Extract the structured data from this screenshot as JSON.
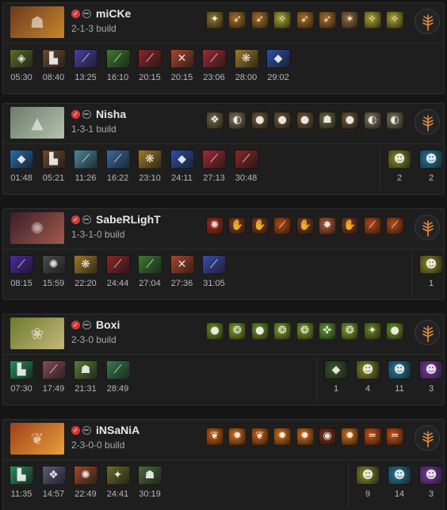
{
  "colors": {
    "background": "#151515",
    "card": "#1e1e1e",
    "check_badge": "#d23a3a",
    "talent_accent": "#e08a3c"
  },
  "players": [
    {
      "name": "miCKe",
      "build": "2-1-3 build",
      "portrait": {
        "hero_icon": "monkey-king-portrait",
        "glyph": "☗",
        "colors": [
          "#6a3a1c",
          "#c9852f"
        ]
      },
      "abilities": [
        {
          "icon": "jingu-mastery-icon",
          "glyph": "✦",
          "color": "#8d7a2e"
        },
        {
          "icon": "boundless-strike-icon",
          "glyph": "➶",
          "color": "#a4702c"
        },
        {
          "icon": "boundless-strike-icon",
          "glyph": "➶",
          "color": "#a4702c"
        },
        {
          "icon": "tree-dance-icon",
          "glyph": "✧",
          "color": "#a8a633"
        },
        {
          "icon": "boundless-strike-icon",
          "glyph": "➶",
          "color": "#a4702c"
        },
        {
          "icon": "boundless-strike-icon",
          "glyph": "➶",
          "color": "#a4702c"
        },
        {
          "icon": "primal-spring-icon",
          "glyph": "✶",
          "color": "#8c6a44"
        },
        {
          "icon": "tree-dance-icon",
          "glyph": "✧",
          "color": "#a8a633"
        },
        {
          "icon": "tree-dance-icon",
          "glyph": "✧",
          "color": "#a8a633"
        }
      ],
      "items": [
        {
          "icon": "quelling-blade-icon",
          "glyph": "◈",
          "color": "#5d6b2a",
          "time": "05:30"
        },
        {
          "icon": "power-treads-icon",
          "glyph": "▙",
          "color": "#6b4a2e",
          "time": "08:40"
        },
        {
          "icon": "echo-sabre-icon",
          "glyph": "⟋",
          "color": "#4a3fa0",
          "time": "13:25"
        },
        {
          "icon": "mage-slayer-icon",
          "glyph": "⟋",
          "color": "#3b7a2e",
          "time": "16:10"
        },
        {
          "icon": "desolator-icon",
          "glyph": "⟋",
          "color": "#8a2626",
          "time": "20:15"
        },
        {
          "icon": "bfury-icon",
          "glyph": "✕",
          "color": "#a8462a",
          "time": "20:15"
        },
        {
          "icon": "daedalus-icon",
          "glyph": "⟋",
          "color": "#9c2b34",
          "time": "23:06"
        },
        {
          "icon": "butterfly-icon",
          "glyph": "❋",
          "color": "#9c7a2a",
          "time": "28:00"
        },
        {
          "icon": "black-king-bar-icon",
          "glyph": "◆",
          "color": "#2d4fa3",
          "time": "29:02"
        }
      ],
      "neutral_items": []
    },
    {
      "name": "Nisha",
      "build": "1-3-1 build",
      "portrait": {
        "hero_icon": "tiny-portrait",
        "glyph": "▲",
        "colors": [
          "#6c7d6a",
          "#b3c2ad"
        ]
      },
      "abilities": [
        {
          "icon": "avalanche-icon",
          "glyph": "❖",
          "color": "#6b6a4a"
        },
        {
          "icon": "toss-icon",
          "glyph": "◐",
          "color": "#7a7562"
        },
        {
          "icon": "tree-grab-icon",
          "glyph": "●",
          "color": "#6e5a3e"
        },
        {
          "icon": "tree-grab-icon",
          "glyph": "●",
          "color": "#6e5a3e"
        },
        {
          "icon": "tree-grab-icon",
          "glyph": "●",
          "color": "#6e5a3e"
        },
        {
          "icon": "tiny-grow-icon",
          "glyph": "☗",
          "color": "#6a6a4a"
        },
        {
          "icon": "tree-grab-icon",
          "glyph": "●",
          "color": "#6e5a3e"
        },
        {
          "icon": "toss-icon",
          "glyph": "◐",
          "color": "#7a7562"
        },
        {
          "icon": "toss-icon",
          "glyph": "◐",
          "color": "#7a7562"
        }
      ],
      "items": [
        {
          "icon": "magic-wand-icon",
          "glyph": "◆",
          "color": "#2a6aa8",
          "time": "01:48"
        },
        {
          "icon": "phase-boots-icon",
          "glyph": "▙",
          "color": "#6b4a2e",
          "time": "05:21"
        },
        {
          "icon": "blink-dagger-icon",
          "glyph": "⟋",
          "color": "#4a8a9a",
          "time": "11:26"
        },
        {
          "icon": "echo-sabre-icon",
          "glyph": "⟋",
          "color": "#3a6aa0",
          "time": "16:22"
        },
        {
          "icon": "assault-cuirass-icon",
          "glyph": "❋",
          "color": "#9c7a2a",
          "time": "23:10"
        },
        {
          "icon": "black-king-bar-icon",
          "glyph": "◆",
          "color": "#2d4fa3",
          "time": "24:11"
        },
        {
          "icon": "daedalus-icon",
          "glyph": "⟋",
          "color": "#9c2b34",
          "time": "27:13"
        },
        {
          "icon": "satanic-icon",
          "glyph": "⟋",
          "color": "#8a2626",
          "time": "30:48"
        }
      ],
      "neutral_items": [
        {
          "icon": "neutral-token-tier1-icon",
          "glyph": "☻",
          "color": "#8a8a28",
          "count": "2"
        },
        {
          "icon": "neutral-token-tier2-icon",
          "glyph": "☻",
          "color": "#2a7a9a",
          "count": "2"
        }
      ]
    },
    {
      "name": "SabeRLighT",
      "build": "1-3-1-0 build",
      "portrait": {
        "hero_icon": "ursa-portrait",
        "glyph": "✺",
        "colors": [
          "#3a1e2c",
          "#a25a4a"
        ]
      },
      "abilities": [
        {
          "icon": "earthshock-icon",
          "glyph": "✺",
          "color": "#a42e1e"
        },
        {
          "icon": "fury-swipes-icon",
          "glyph": "✋",
          "color": "#7a3a2e"
        },
        {
          "icon": "fury-swipes-icon",
          "glyph": "✋",
          "color": "#7a3a2e"
        },
        {
          "icon": "overpower-icon",
          "glyph": "⟋",
          "color": "#b04a1e"
        },
        {
          "icon": "fury-swipes-icon",
          "glyph": "✋",
          "color": "#7a3a2e"
        },
        {
          "icon": "enrage-icon",
          "glyph": "✸",
          "color": "#b05a3a"
        },
        {
          "icon": "fury-swipes-icon",
          "glyph": "✋",
          "color": "#7a3a2e"
        },
        {
          "icon": "overpower-icon",
          "glyph": "⟋",
          "color": "#b04a1e"
        },
        {
          "icon": "overpower-icon",
          "glyph": "⟋",
          "color": "#b04a1e"
        }
      ],
      "items": [
        {
          "icon": "diffusal-blade-icon",
          "glyph": "⟋",
          "color": "#4a2a9a",
          "time": "08:15"
        },
        {
          "icon": "skull-basher-icon",
          "glyph": "✺",
          "color": "#4a4a4a",
          "time": "15:59"
        },
        {
          "icon": "butterfly-icon",
          "glyph": "❋",
          "color": "#9c7a2a",
          "time": "22:20"
        },
        {
          "icon": "abyssal-blade-icon",
          "glyph": "⟋",
          "color": "#8a2626",
          "time": "24:44"
        },
        {
          "icon": "mage-slayer-icon",
          "glyph": "⟋",
          "color": "#3b7a2e",
          "time": "27:04"
        },
        {
          "icon": "bfury-icon",
          "glyph": "✕",
          "color": "#a8462a",
          "time": "27:36"
        },
        {
          "icon": "skadi-icon",
          "glyph": "⟋",
          "color": "#3a4aa8",
          "time": "31:05"
        }
      ],
      "neutral_items": [
        {
          "icon": "neutral-token-tier1-icon",
          "glyph": "☻",
          "color": "#8a8a28",
          "count": "1"
        }
      ]
    },
    {
      "name": "Boxi",
      "build": "2-3-0 build",
      "portrait": {
        "hero_icon": "hoodwink-portrait",
        "glyph": "❀",
        "colors": [
          "#6a7a2e",
          "#c8b87a"
        ]
      },
      "abilities": [
        {
          "icon": "acorn-shot-icon",
          "glyph": "●",
          "color": "#6a9a2e"
        },
        {
          "icon": "bushwhack-icon",
          "glyph": "❂",
          "color": "#7aa232"
        },
        {
          "icon": "acorn-shot-icon",
          "glyph": "●",
          "color": "#6a9a2e"
        },
        {
          "icon": "bushwhack-icon",
          "glyph": "❂",
          "color": "#7aa232"
        },
        {
          "icon": "bushwhack-icon",
          "glyph": "❂",
          "color": "#7aa232"
        },
        {
          "icon": "sharpshooter-icon",
          "glyph": "✜",
          "color": "#5a9a3a"
        },
        {
          "icon": "bushwhack-icon",
          "glyph": "❂",
          "color": "#7aa232"
        },
        {
          "icon": "scurry-icon",
          "glyph": "✦",
          "color": "#6a8a2e"
        },
        {
          "icon": "acorn-shot-icon",
          "glyph": "●",
          "color": "#6a9a2e"
        }
      ],
      "items": [
        {
          "icon": "tranquil-boots-icon",
          "glyph": "▙",
          "color": "#2a8a5a",
          "time": "07:30"
        },
        {
          "icon": "force-staff-icon",
          "glyph": "⟋",
          "color": "#8a4a5a",
          "time": "17:49"
        },
        {
          "icon": "ghost-scepter-icon",
          "glyph": "☗",
          "color": "#5a7a3a",
          "time": "21:31"
        },
        {
          "icon": "rod-of-atos-icon",
          "glyph": "⟋",
          "color": "#3a7a4a",
          "time": "28:49"
        }
      ],
      "neutral_items": [
        {
          "icon": "neutral-item-tier0-icon",
          "glyph": "◆",
          "color": "#3a5a2a",
          "count": "1"
        },
        {
          "icon": "neutral-token-tier1-icon",
          "glyph": "☻",
          "color": "#8a8a28",
          "count": "4"
        },
        {
          "icon": "neutral-token-tier2-icon",
          "glyph": "☻",
          "color": "#2a7a9a",
          "count": "11"
        },
        {
          "icon": "neutral-token-tier3-icon",
          "glyph": "☻",
          "color": "#7a3aa0",
          "count": "3"
        }
      ]
    },
    {
      "name": "iNSaNiA",
      "build": "2-3-0-0 build",
      "portrait": {
        "hero_icon": "phoenix-portrait",
        "glyph": "❦",
        "colors": [
          "#a0401a",
          "#e8a03a"
        ]
      },
      "abilities": [
        {
          "icon": "icarus-dive-icon",
          "glyph": "❦",
          "color": "#c8621a"
        },
        {
          "icon": "fire-spirits-icon",
          "glyph": "✹",
          "color": "#d0701e"
        },
        {
          "icon": "icarus-dive-icon",
          "glyph": "❦",
          "color": "#c8621a"
        },
        {
          "icon": "fire-spirits-icon",
          "glyph": "✹",
          "color": "#d0701e"
        },
        {
          "icon": "fire-spirits-icon",
          "glyph": "✹",
          "color": "#d0701e"
        },
        {
          "icon": "supernova-icon",
          "glyph": "◉",
          "color": "#7a2e1a"
        },
        {
          "icon": "fire-spirits-icon",
          "glyph": "✹",
          "color": "#d0701e"
        },
        {
          "icon": "sun-ray-icon",
          "glyph": "═",
          "color": "#c8521a"
        },
        {
          "icon": "sun-ray-icon",
          "glyph": "═",
          "color": "#c8521a"
        }
      ],
      "items": [
        {
          "icon": "tranquil-boots-icon",
          "glyph": "▙",
          "color": "#2a8a5a",
          "time": "11:35"
        },
        {
          "icon": "veil-of-discord-icon",
          "glyph": "❖",
          "color": "#5a5a7a",
          "time": "14:57"
        },
        {
          "icon": "shivas-guard-icon",
          "glyph": "✺",
          "color": "#9a4a2a",
          "time": "22:49"
        },
        {
          "icon": "spirit-vessel-icon",
          "glyph": "✦",
          "color": "#6a6a2a",
          "time": "24:41"
        },
        {
          "icon": "heart-of-tarrasque-icon",
          "glyph": "☗",
          "color": "#4a6a3a",
          "time": "30:19"
        }
      ],
      "neutral_items": [
        {
          "icon": "neutral-token-tier1-icon",
          "glyph": "☻",
          "color": "#8a8a28",
          "count": "9"
        },
        {
          "icon": "neutral-token-tier2-icon",
          "glyph": "☻",
          "color": "#2a7a9a",
          "count": "14"
        },
        {
          "icon": "neutral-token-tier3-icon",
          "glyph": "☻",
          "color": "#7a3aa0",
          "count": "3"
        }
      ]
    }
  ]
}
